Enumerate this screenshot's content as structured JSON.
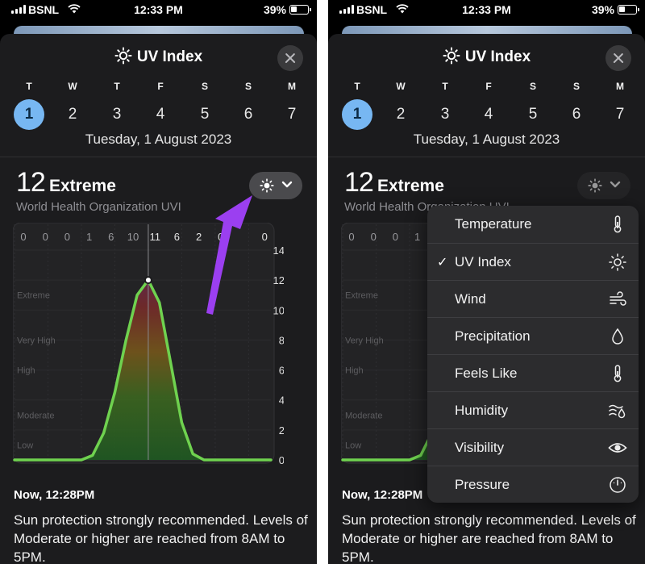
{
  "status_bar": {
    "carrier": "BSNL",
    "time": "12:33 PM",
    "battery": "39%"
  },
  "panel": {
    "title": "UV Index",
    "days": [
      {
        "letter": "T",
        "num": "1",
        "selected": true
      },
      {
        "letter": "W",
        "num": "2"
      },
      {
        "letter": "T",
        "num": "3"
      },
      {
        "letter": "F",
        "num": "4"
      },
      {
        "letter": "S",
        "num": "5"
      },
      {
        "letter": "S",
        "num": "6"
      },
      {
        "letter": "M",
        "num": "7"
      }
    ],
    "date": "Tuesday, 1 August 2023",
    "uv_value": "12",
    "uv_level": "Extreme",
    "source": "World Health Organization UVI",
    "now": "Now, 12:28PM",
    "description": "Sun protection strongly recommended. Levels of Moderate or higher are reached from 8AM to 5PM."
  },
  "chart_data": {
    "type": "area",
    "hourly_labels": [
      "0",
      "0",
      "0",
      "1",
      "6",
      "10",
      "11",
      "6",
      "2",
      "0",
      "",
      "0"
    ],
    "y_ticks": [
      "14",
      "12",
      "10",
      "8",
      "6",
      "4",
      "2",
      "0"
    ],
    "ylim": [
      0,
      14
    ],
    "bands": [
      "Extreme",
      "Very High",
      "High",
      "Moderate",
      "Low"
    ],
    "x": [
      0,
      1,
      2,
      3,
      4,
      5,
      6,
      7,
      8,
      9,
      10,
      11,
      12,
      13,
      14,
      15,
      16,
      17,
      18,
      19,
      20,
      21,
      22,
      23
    ],
    "values": [
      0,
      0,
      0,
      0,
      0,
      0,
      0,
      0.3,
      1.8,
      4.5,
      8,
      11,
      12,
      10.5,
      6.5,
      2.5,
      0.4,
      0,
      0,
      0,
      0,
      0,
      0,
      0
    ],
    "current": {
      "x": 12,
      "y": 12
    }
  },
  "menu": {
    "items": [
      {
        "label": "Temperature",
        "icon": "thermometer-icon"
      },
      {
        "label": "UV Index",
        "icon": "sun-icon",
        "checked": true,
        "check": "✓"
      },
      {
        "label": "Wind",
        "icon": "wind-icon"
      },
      {
        "label": "Precipitation",
        "icon": "droplet-icon"
      },
      {
        "label": "Feels Like",
        "icon": "thermometer-icon"
      },
      {
        "label": "Humidity",
        "icon": "humidity-icon"
      },
      {
        "label": "Visibility",
        "icon": "eye-icon"
      },
      {
        "label": "Pressure",
        "icon": "gauge-icon"
      }
    ]
  },
  "colors": {
    "accent": "#77b7f2",
    "arrow": "#9b3ff0",
    "sheet": "#1c1c1e"
  }
}
